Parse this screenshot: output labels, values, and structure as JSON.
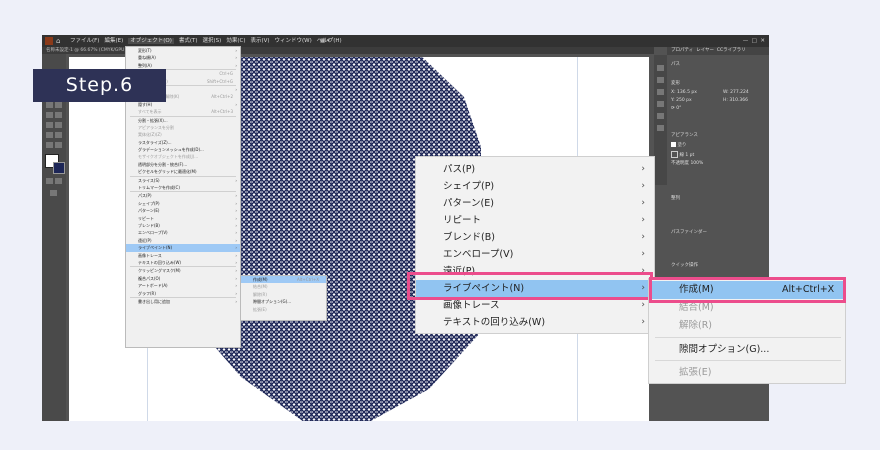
{
  "step_label": "Step.6",
  "menubar": {
    "items": [
      "ファイル(F)",
      "編集(E)",
      "オブジェクト(O)",
      "書式(T)",
      "選択(S)",
      "効果(C)",
      "表示(V)",
      "ウィンドウ(W)",
      "ヘルプ(H)"
    ],
    "active_index": 2
  },
  "document_tab": "名称未設定-1 @ 66.67% (CMYK/GPU プレビュー)",
  "right_panel": {
    "tabs": [
      "プロパティ",
      "レイヤー",
      "CCライブラリ"
    ],
    "section_path": "パス",
    "section_transform": "変形",
    "x_label": "X:",
    "x_value": "136.5 px",
    "y_label": "Y:",
    "y_value": "250 px",
    "w_label": "W:",
    "w_value": "277.224",
    "h_label": "H:",
    "h_value": "310.366",
    "angle_value": "0°",
    "section_appearance": "アピアランス",
    "fill_label": "塗り",
    "stroke_label": "線",
    "stroke_value": "1 pt",
    "opacity_label": "不透明度",
    "opacity_value": "100%",
    "section_align": "整列",
    "section_pathfinder": "パスファインダー",
    "section_quick": "クイック操作"
  },
  "small_menu": {
    "rows": [
      {
        "label": "変形(T)",
        "arrow": true,
        "disabled": false
      },
      {
        "label": "重ね順(A)",
        "arrow": true,
        "disabled": false
      },
      {
        "label": "整列(A)",
        "arrow": true,
        "disabled": false
      },
      {
        "label": "グループ(G)",
        "shortcut": "Ctrl+G",
        "disabled": false
      },
      {
        "label": "グループ解除(U)",
        "shortcut": "Shift+Ctrl+G",
        "disabled": true
      },
      {
        "label": "ロック(L)",
        "arrow": true,
        "disabled": false
      },
      {
        "label": "すべてをロック解除(K)",
        "shortcut": "Alt+Ctrl+2",
        "disabled": true
      },
      {
        "label": "隠す(H)",
        "arrow": true,
        "disabled": false
      },
      {
        "label": "すべてを表示",
        "shortcut": "Alt+Ctrl+3",
        "disabled": true
      },
      {
        "label": "分割・拡張(X)...",
        "disabled": false
      },
      {
        "label": "アピアランスを分割",
        "disabled": true
      },
      {
        "label": "実体化(Z)(Z)",
        "disabled": true
      },
      {
        "label": "ラスタライズ(Z)...",
        "disabled": false
      },
      {
        "label": "グラデーションメッシュを作成(D)...",
        "disabled": false
      },
      {
        "label": "モザイクオブジェクトを作成(J)...",
        "disabled": true
      },
      {
        "label": "透明部分を分割・統合(F)...",
        "disabled": false
      },
      {
        "label": "ピクセルをグリッドに最適化(M)",
        "disabled": false
      },
      {
        "label": "スライス(S)",
        "arrow": true,
        "disabled": false
      },
      {
        "label": "トリムマークを作成(C)",
        "disabled": false
      },
      {
        "label": "パス(P)",
        "arrow": true,
        "disabled": false
      },
      {
        "label": "シェイプ(P)",
        "arrow": true,
        "disabled": false
      },
      {
        "label": "パターン(E)",
        "arrow": true,
        "disabled": false
      },
      {
        "label": "リピート",
        "arrow": true,
        "disabled": false
      },
      {
        "label": "ブレンド(B)",
        "arrow": true,
        "disabled": false
      },
      {
        "label": "エンベロープ(V)",
        "arrow": true,
        "disabled": false
      },
      {
        "label": "遠近(P)",
        "arrow": true,
        "disabled": false
      },
      {
        "label": "ライブペイント(N)",
        "arrow": true,
        "highlight": true,
        "disabled": false
      },
      {
        "label": "画像トレース",
        "arrow": true,
        "disabled": false
      },
      {
        "label": "テキストの回り込み(W)",
        "arrow": true,
        "disabled": false
      },
      {
        "label": "クリッピングマスク(M)",
        "arrow": true,
        "disabled": false
      },
      {
        "label": "複合パス(O)",
        "arrow": true,
        "disabled": false
      },
      {
        "label": "アートボード(A)",
        "arrow": true,
        "disabled": false
      },
      {
        "label": "グラフ(R)",
        "arrow": true,
        "disabled": false
      },
      {
        "label": "書き出し用に追加",
        "arrow": true,
        "disabled": false
      }
    ]
  },
  "small_submenu": {
    "rows": [
      {
        "label": "作成(M)",
        "shortcut": "Alt+Ctrl+X",
        "highlight": true,
        "disabled": false
      },
      {
        "label": "結合(M)",
        "disabled": true
      },
      {
        "label": "解除(R)",
        "disabled": true
      },
      {
        "label": "隙間オプション(G)...",
        "disabled": false
      },
      {
        "label": "拡張(E)",
        "disabled": true
      }
    ]
  },
  "big_menu": {
    "rows": [
      {
        "label": "パス(P)",
        "arrow": true
      },
      {
        "label": "シェイプ(P)",
        "arrow": true
      },
      {
        "label": "パターン(E)",
        "arrow": true
      },
      {
        "label": "リピート",
        "arrow": true
      },
      {
        "label": "ブレンド(B)",
        "arrow": true
      },
      {
        "label": "エンベロープ(V)",
        "arrow": true
      },
      {
        "label": "遠近(P)",
        "arrow": true
      },
      {
        "label": "ライブペイント(N)",
        "arrow": true,
        "highlight": true
      },
      {
        "label": "画像トレース",
        "arrow": true
      },
      {
        "label": "テキストの回り込み(W)",
        "arrow": true
      }
    ]
  },
  "big_submenu": {
    "create_label": "作成(M)",
    "create_shortcut": "Alt+Ctrl+X",
    "merge_label": "結合(M)",
    "release_label": "解除(R)",
    "gap_label": "隙間オプション(G)...",
    "expand_label": "拡張(E)"
  },
  "colors": {
    "highlight_border": "#ec4d8c",
    "menu_highlight": "#91c4f1",
    "step_badge": "#2e3256",
    "artwork_stroke": "#1d2657"
  }
}
